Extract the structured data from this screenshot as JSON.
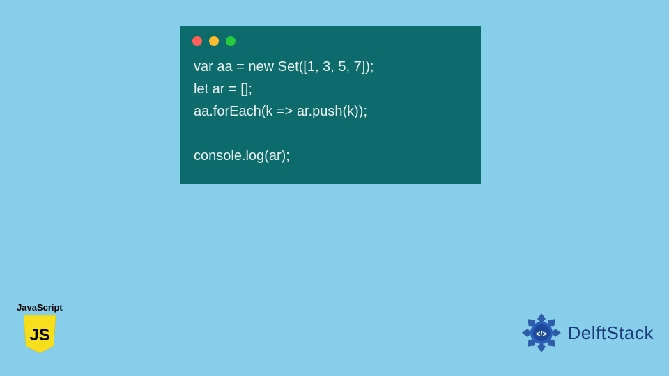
{
  "code_window": {
    "lines": [
      "var aa = new Set([1, 3, 5, 7]);",
      "let ar = [];",
      "aa.forEach(k => ar.push(k));",
      "",
      "console.log(ar);"
    ],
    "dots": [
      "red",
      "yellow",
      "green"
    ]
  },
  "js_badge": {
    "label": "JavaScript",
    "shield_text": "JS",
    "shield_bg": "#f7df1e",
    "shield_fg": "#000000"
  },
  "delft": {
    "text": "DelftStack",
    "icon_glyph": "</>",
    "primary": "#1e4a9c",
    "accent": "#2a5fb8"
  }
}
